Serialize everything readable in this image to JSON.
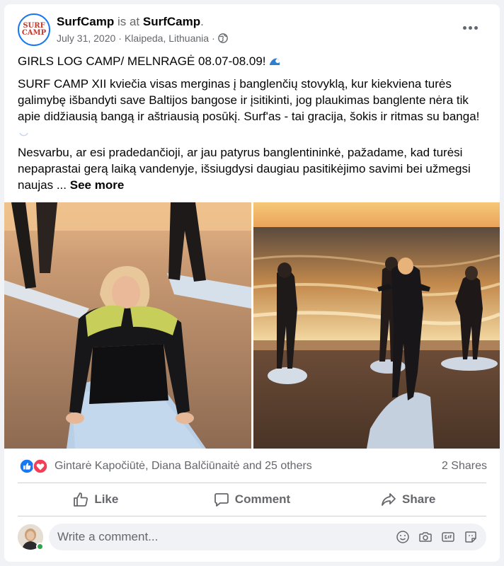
{
  "post": {
    "author": "SurfCamp",
    "is_at_text": "is at",
    "place": "SurfCamp",
    "place_suffix": ".",
    "date": "July 31, 2020",
    "location": "Klaipeda, Lithuania",
    "sep": "·",
    "logo_line1": "SURF",
    "logo_line2": "CAMP",
    "title_line": "GIRLS LOG CAMP/ MELNRAGĖ 08.07-08.09!",
    "paragraph1": "SURF CAMP XII kviečia visas merginas į banglenčių stovyklą, kur kiekviena turės galimybę išbandyti save Baltijos bangose ir įsitikinti, jog plaukimas banglente nėra tik apie didžiausią bangą ir aštriausią posūkį. Surf'as - tai gracija, šokis ir ritmas su banga!",
    "paragraph2": "Nesvarbu, ar esi pradedančioji, ar jau patyrus banglentininkė, pažadame, kad turėsi nepaprastai gerą laiką vandenyje, išsiugdysi daugiau pasitikėjimo savimi bei užmegsi naujas ...",
    "see_more": "See more"
  },
  "reactions": {
    "names": "Gintarė Kapočiūtė, Diana Balčiūnaitė and 25 others",
    "shares": "2 Shares"
  },
  "actions": {
    "like": "Like",
    "comment": "Comment",
    "share": "Share"
  },
  "comment": {
    "placeholder": "Write a comment..."
  },
  "icons": [
    "globe-icon",
    "more-options-icon",
    "wave-emoji-icon",
    "like-reaction-icon",
    "love-reaction-icon",
    "like-icon",
    "comment-icon",
    "share-icon",
    "emoji-icon",
    "camera-icon",
    "gif-icon",
    "sticker-icon"
  ],
  "colors": {
    "brand": "#1877f2",
    "love": "#f33e58",
    "muted": "#65676b",
    "online": "#31a24c"
  }
}
